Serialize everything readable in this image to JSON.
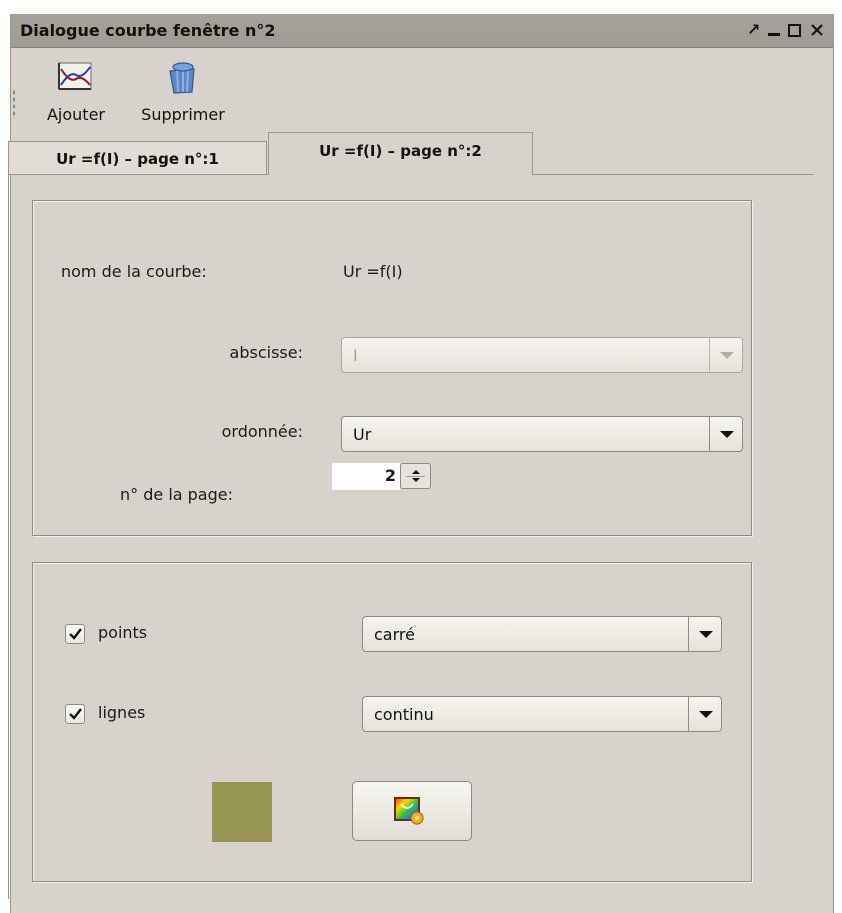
{
  "window": {
    "title": "Dialogue courbe fenêtre n°2",
    "controls": [
      "restore-icon",
      "minimize-icon",
      "maximize-icon",
      "close-icon"
    ]
  },
  "toolbar": {
    "add_label": "Ajouter",
    "add_icon": "chart-add-icon",
    "remove_label": "Supprimer",
    "remove_icon": "trash-icon"
  },
  "tabs": [
    {
      "label": "Ur =f(I) – page n°:1",
      "selected": false
    },
    {
      "label": "Ur =f(I) – page n°:2",
      "selected": true
    }
  ],
  "curve": {
    "name_label": "nom de la courbe:",
    "name_value": "Ur =f(I)",
    "abscissa_label": "abscisse:",
    "abscissa_value": "I",
    "ordinate_label": "ordonnée:",
    "ordinate_value": "Ur",
    "page_label": "n° de la page:",
    "page_value": "2"
  },
  "style": {
    "points_label": "points",
    "points_checked": true,
    "points_shape": "carré",
    "lines_label": "lignes",
    "lines_checked": true,
    "lines_style": "continu",
    "curve_color": "#979552",
    "color_button_icon": "color-picker-icon"
  }
}
